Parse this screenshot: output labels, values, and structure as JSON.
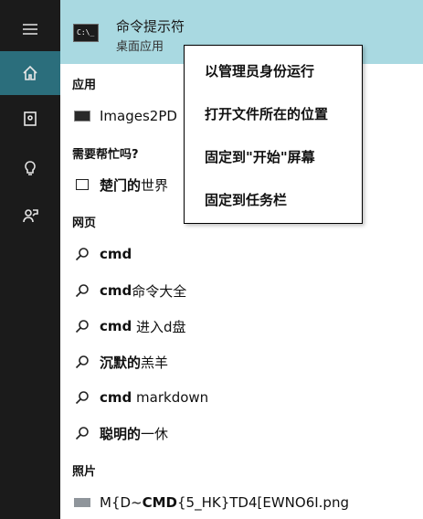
{
  "rail": {
    "items": [
      {
        "icon": "hamburger-menu-icon",
        "active": false
      },
      {
        "icon": "home-icon",
        "active": true
      },
      {
        "icon": "document-icon",
        "active": false
      },
      {
        "icon": "lightbulb-icon",
        "active": false
      },
      {
        "icon": "feedback-person-icon",
        "active": false
      }
    ]
  },
  "best_match": {
    "title": "命令提示符",
    "subtitle": "桌面应用",
    "icon_text": "C:\\_"
  },
  "sections": {
    "apps": "应用",
    "help": "需要帮忙吗?",
    "web": "网页",
    "photos": "照片"
  },
  "app_items": [
    {
      "label": "Images2PD"
    }
  ],
  "help_items": [
    {
      "bold": "楚门的",
      "normal": "世界"
    }
  ],
  "web_items": [
    {
      "bold": "cmd",
      "normal": ""
    },
    {
      "bold": "cmd",
      "normal": "命令大全"
    },
    {
      "bold": "cmd",
      "normal": " 进入d盘"
    },
    {
      "bold": "沉默的",
      "normal": "羔羊"
    },
    {
      "bold": "cmd",
      "normal": " markdown"
    },
    {
      "bold": "聪明的",
      "normal": "一休"
    }
  ],
  "photo_items": [
    {
      "pre": "M{D~",
      "bold": "CMD",
      "post": "{5_HK}TD4[EWNO6I.png"
    }
  ],
  "context_menu": {
    "items": [
      "以管理员身份运行",
      "打开文件所在的位置",
      "固定到\"开始\"屏幕",
      "固定到任务栏"
    ]
  },
  "colors": {
    "rail_bg": "#1b1b1b",
    "rail_active": "#2b6e7c",
    "highlight": "#a9d9e1"
  }
}
